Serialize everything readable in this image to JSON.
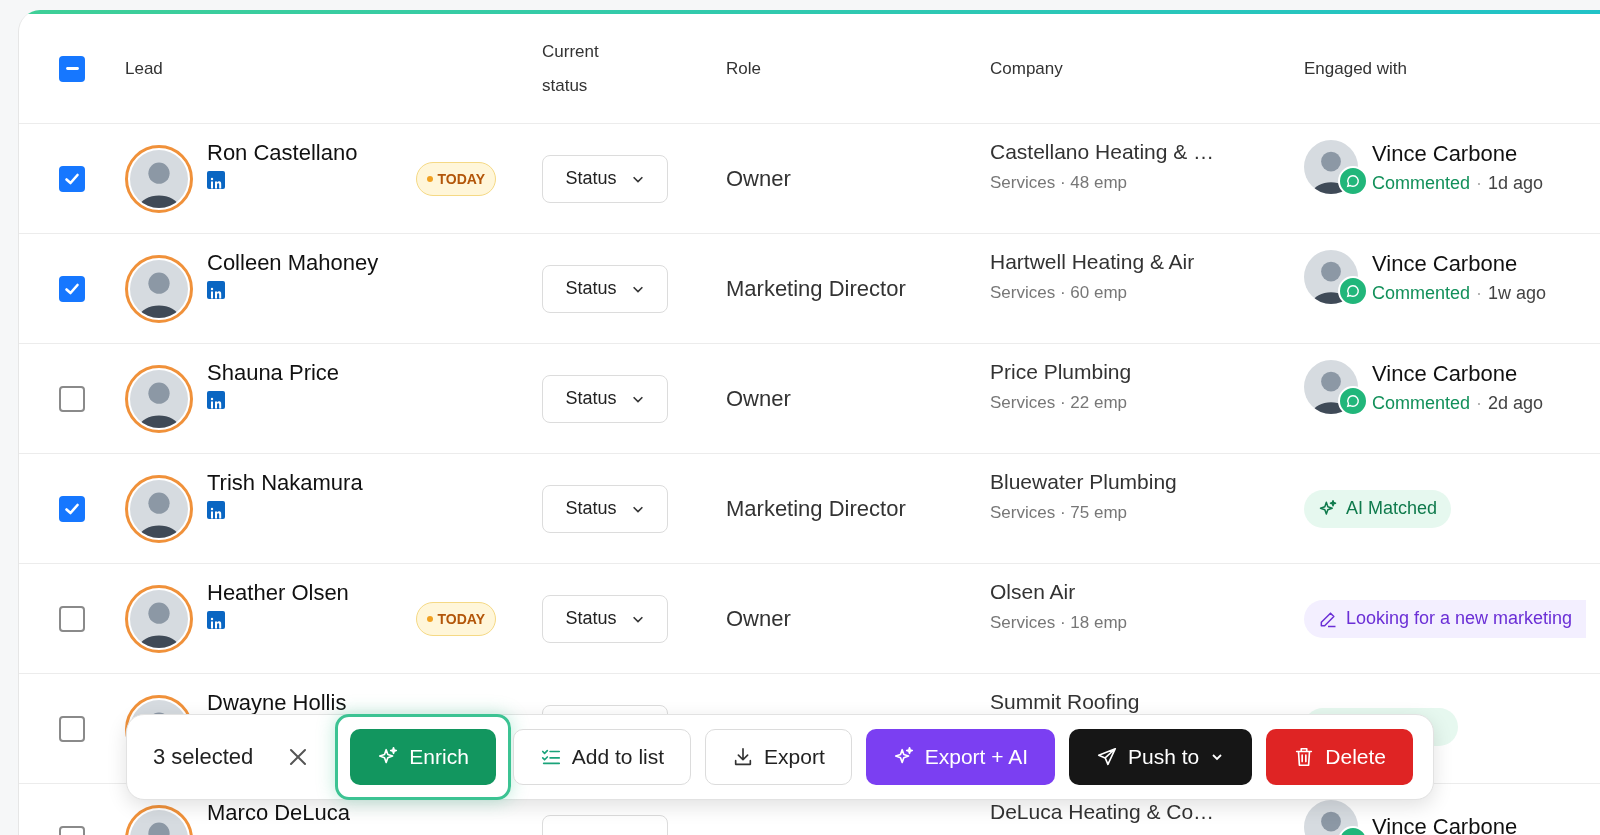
{
  "table": {
    "select_all": {
      "partial": true
    },
    "columns": [
      "Lead",
      "Current status",
      "Role",
      "Company",
      "Engaged with"
    ],
    "rows": [
      {
        "selected": true,
        "name": "Ron Castellano",
        "linkedin": true,
        "badge": "TODAY",
        "status": "Status",
        "role": "Owner",
        "company": "Castellano Heating & …",
        "company_meta": "Services · 48 emp",
        "engaged": {
          "kind": "person",
          "name": "Vince Carbone",
          "action": "Commented",
          "sep": "·",
          "time": "1d ago"
        }
      },
      {
        "selected": true,
        "name": "Colleen Mahoney",
        "linkedin": true,
        "status": "Status",
        "role": "Marketing Director",
        "company": "Hartwell Heating & Air",
        "company_meta": "Services · 60 emp",
        "engaged": {
          "kind": "person",
          "name": "Vince Carbone",
          "action": "Commented",
          "sep": "·",
          "time": "1w ago"
        }
      },
      {
        "selected": false,
        "name": "Shauna Price",
        "linkedin": true,
        "status": "Status",
        "role": "Owner",
        "company": "Price Plumbing",
        "company_meta": "Services · 22 emp",
        "engaged": {
          "kind": "person",
          "name": "Vince Carbone",
          "action": "Commented",
          "sep": "·",
          "time": "2d ago"
        }
      },
      {
        "selected": true,
        "name": "Trish Nakamura",
        "linkedin": true,
        "status": "Status",
        "role": "Marketing Director",
        "company": "Bluewater Plumbing",
        "company_meta": "Services · 75 emp",
        "engaged": {
          "kind": "ai",
          "label": "AI Matched"
        }
      },
      {
        "selected": false,
        "name": "Heather Olsen",
        "linkedin": true,
        "badge": "TODAY",
        "status": "Status",
        "role": "Owner",
        "company": "Olsen Air",
        "company_meta": "Services · 18 emp",
        "engaged": {
          "kind": "note",
          "label": "Looking for a new marketing"
        }
      },
      {
        "selected": false,
        "name": "Dwayne Hollis",
        "linkedin": false,
        "company": "Summit Roofing",
        "engaged": {
          "kind": "ai"
        }
      },
      {
        "selected": false,
        "name": "Marco DeLuca",
        "linkedin": false,
        "company": "DeLuca Heating & Co…",
        "engaged": {
          "kind": "person",
          "name": "Vince Carbone"
        }
      }
    ]
  },
  "action_bar": {
    "count": "3 selected",
    "actions": [
      {
        "kind": "enrich",
        "label": "Enrich",
        "focused": true
      },
      {
        "kind": "add_list",
        "label": "Add to list",
        "focused": false
      },
      {
        "kind": "export",
        "label": "Export",
        "focused": false
      },
      {
        "kind": "export_ai",
        "label": "Export + AI",
        "focused": false
      },
      {
        "kind": "push",
        "label": "Push to",
        "focused": false
      },
      {
        "kind": "delete",
        "label": "Delete",
        "focused": false
      }
    ]
  }
}
